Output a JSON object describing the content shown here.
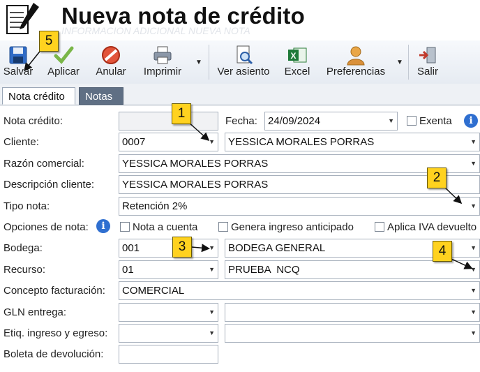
{
  "window": {
    "title": "Nueva nota de crédito",
    "ghost_text": "INFORMACION ADICIONAL NUEVA NOTA"
  },
  "toolbar": {
    "salvar": "Salvar",
    "aplicar": "Aplicar",
    "anular": "Anular",
    "imprimir": "Imprimir",
    "ver_asiento": "Ver asiento",
    "excel": "Excel",
    "preferencias": "Preferencias",
    "salir": "Salir"
  },
  "tabs": [
    "Nota crédito",
    "Notas"
  ],
  "form": {
    "nota_credito_label": "Nota crédito:",
    "fecha_label": "Fecha:",
    "fecha_value": "24/09/2024",
    "exenta_label": "Exenta",
    "cliente_label": "Cliente:",
    "cliente_code": "0007",
    "cliente_name": "YESSICA MORALES PORRAS",
    "razon_label": "Razón comercial:",
    "razon_value": "YESSICA MORALES PORRAS",
    "descripcion_label": "Descripción cliente:",
    "descripcion_value": "YESSICA MORALES PORRAS",
    "tipo_label": "Tipo nota:",
    "tipo_value": "Retención 2%",
    "opciones_label": "Opciones de nota:",
    "nota_cuenta_label": "Nota a cuenta",
    "genera_ingreso_label": "Genera ingreso anticipado",
    "aplica_iva_label": "Aplica IVA devuelto",
    "bodega_label": "Bodega:",
    "bodega_code": "001",
    "bodega_name": "BODEGA GENERAL",
    "recurso_label": "Recurso:",
    "recurso_code": "01",
    "recurso_name": "PRUEBA  NCQ",
    "concepto_label": "Concepto facturación:",
    "concepto_value": "COMERCIAL",
    "gln_label": "GLN entrega:",
    "etiq_label": "Etiq. ingreso y egreso:",
    "boleta_label": "Boleta de devolución:"
  },
  "callouts": [
    "1",
    "2",
    "3",
    "4",
    "5"
  ],
  "colors": {
    "callout": "#ffd21f",
    "tab_inactive": "#5f6f84",
    "info": "#2f6fd0"
  }
}
